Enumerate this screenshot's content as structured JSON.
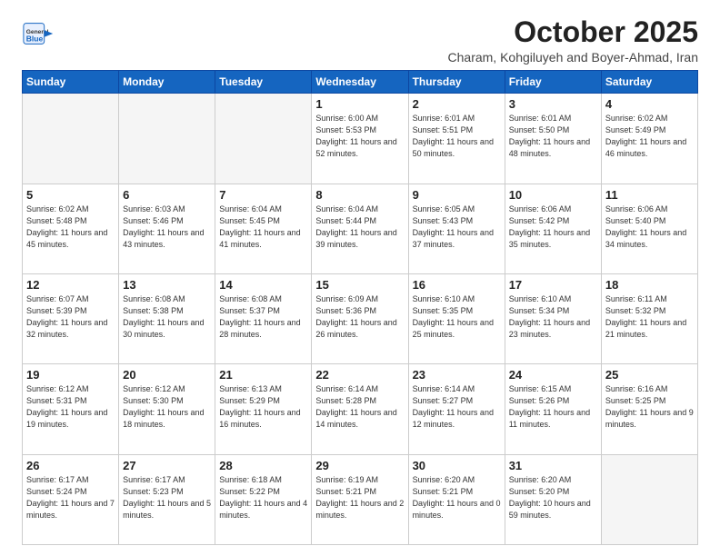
{
  "header": {
    "logo": {
      "general": "General",
      "blue": "Blue"
    },
    "month": "October 2025",
    "location": "Charam, Kohgiluyeh and Boyer-Ahmad, Iran"
  },
  "days_of_week": [
    "Sunday",
    "Monday",
    "Tuesday",
    "Wednesday",
    "Thursday",
    "Friday",
    "Saturday"
  ],
  "weeks": [
    [
      {
        "day": "",
        "info": ""
      },
      {
        "day": "",
        "info": ""
      },
      {
        "day": "",
        "info": ""
      },
      {
        "day": "1",
        "info": "Sunrise: 6:00 AM\nSunset: 5:53 PM\nDaylight: 11 hours and 52 minutes."
      },
      {
        "day": "2",
        "info": "Sunrise: 6:01 AM\nSunset: 5:51 PM\nDaylight: 11 hours and 50 minutes."
      },
      {
        "day": "3",
        "info": "Sunrise: 6:01 AM\nSunset: 5:50 PM\nDaylight: 11 hours and 48 minutes."
      },
      {
        "day": "4",
        "info": "Sunrise: 6:02 AM\nSunset: 5:49 PM\nDaylight: 11 hours and 46 minutes."
      }
    ],
    [
      {
        "day": "5",
        "info": "Sunrise: 6:02 AM\nSunset: 5:48 PM\nDaylight: 11 hours and 45 minutes."
      },
      {
        "day": "6",
        "info": "Sunrise: 6:03 AM\nSunset: 5:46 PM\nDaylight: 11 hours and 43 minutes."
      },
      {
        "day": "7",
        "info": "Sunrise: 6:04 AM\nSunset: 5:45 PM\nDaylight: 11 hours and 41 minutes."
      },
      {
        "day": "8",
        "info": "Sunrise: 6:04 AM\nSunset: 5:44 PM\nDaylight: 11 hours and 39 minutes."
      },
      {
        "day": "9",
        "info": "Sunrise: 6:05 AM\nSunset: 5:43 PM\nDaylight: 11 hours and 37 minutes."
      },
      {
        "day": "10",
        "info": "Sunrise: 6:06 AM\nSunset: 5:42 PM\nDaylight: 11 hours and 35 minutes."
      },
      {
        "day": "11",
        "info": "Sunrise: 6:06 AM\nSunset: 5:40 PM\nDaylight: 11 hours and 34 minutes."
      }
    ],
    [
      {
        "day": "12",
        "info": "Sunrise: 6:07 AM\nSunset: 5:39 PM\nDaylight: 11 hours and 32 minutes."
      },
      {
        "day": "13",
        "info": "Sunrise: 6:08 AM\nSunset: 5:38 PM\nDaylight: 11 hours and 30 minutes."
      },
      {
        "day": "14",
        "info": "Sunrise: 6:08 AM\nSunset: 5:37 PM\nDaylight: 11 hours and 28 minutes."
      },
      {
        "day": "15",
        "info": "Sunrise: 6:09 AM\nSunset: 5:36 PM\nDaylight: 11 hours and 26 minutes."
      },
      {
        "day": "16",
        "info": "Sunrise: 6:10 AM\nSunset: 5:35 PM\nDaylight: 11 hours and 25 minutes."
      },
      {
        "day": "17",
        "info": "Sunrise: 6:10 AM\nSunset: 5:34 PM\nDaylight: 11 hours and 23 minutes."
      },
      {
        "day": "18",
        "info": "Sunrise: 6:11 AM\nSunset: 5:32 PM\nDaylight: 11 hours and 21 minutes."
      }
    ],
    [
      {
        "day": "19",
        "info": "Sunrise: 6:12 AM\nSunset: 5:31 PM\nDaylight: 11 hours and 19 minutes."
      },
      {
        "day": "20",
        "info": "Sunrise: 6:12 AM\nSunset: 5:30 PM\nDaylight: 11 hours and 18 minutes."
      },
      {
        "day": "21",
        "info": "Sunrise: 6:13 AM\nSunset: 5:29 PM\nDaylight: 11 hours and 16 minutes."
      },
      {
        "day": "22",
        "info": "Sunrise: 6:14 AM\nSunset: 5:28 PM\nDaylight: 11 hours and 14 minutes."
      },
      {
        "day": "23",
        "info": "Sunrise: 6:14 AM\nSunset: 5:27 PM\nDaylight: 11 hours and 12 minutes."
      },
      {
        "day": "24",
        "info": "Sunrise: 6:15 AM\nSunset: 5:26 PM\nDaylight: 11 hours and 11 minutes."
      },
      {
        "day": "25",
        "info": "Sunrise: 6:16 AM\nSunset: 5:25 PM\nDaylight: 11 hours and 9 minutes."
      }
    ],
    [
      {
        "day": "26",
        "info": "Sunrise: 6:17 AM\nSunset: 5:24 PM\nDaylight: 11 hours and 7 minutes."
      },
      {
        "day": "27",
        "info": "Sunrise: 6:17 AM\nSunset: 5:23 PM\nDaylight: 11 hours and 5 minutes."
      },
      {
        "day": "28",
        "info": "Sunrise: 6:18 AM\nSunset: 5:22 PM\nDaylight: 11 hours and 4 minutes."
      },
      {
        "day": "29",
        "info": "Sunrise: 6:19 AM\nSunset: 5:21 PM\nDaylight: 11 hours and 2 minutes."
      },
      {
        "day": "30",
        "info": "Sunrise: 6:20 AM\nSunset: 5:21 PM\nDaylight: 11 hours and 0 minutes."
      },
      {
        "day": "31",
        "info": "Sunrise: 6:20 AM\nSunset: 5:20 PM\nDaylight: 10 hours and 59 minutes."
      },
      {
        "day": "",
        "info": ""
      }
    ]
  ]
}
